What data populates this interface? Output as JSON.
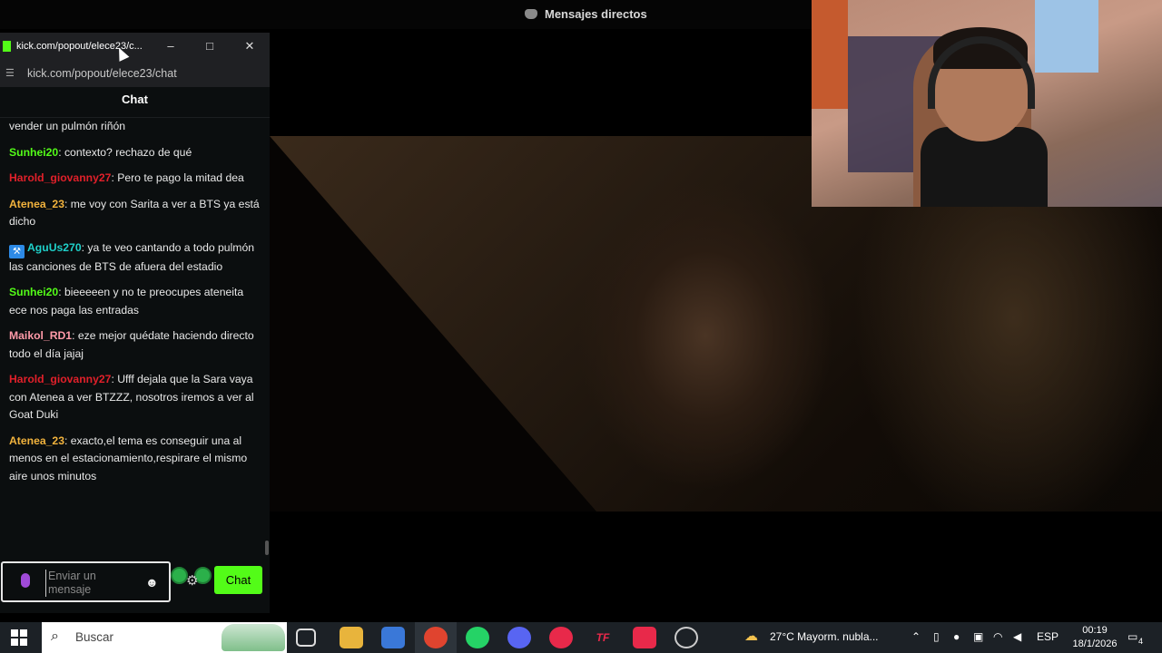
{
  "discord": {
    "title": "Mensajes directos"
  },
  "popout": {
    "title": "kick.com/popout/elece23/c...",
    "url": "kick.com/popout/elece23/chat",
    "minimize": "–",
    "maximize": "□",
    "close": "✕"
  },
  "chat": {
    "header": "Chat",
    "messages": [
      {
        "user": "",
        "text": "vender un pulmón riñón",
        "color": "#e8e8e8"
      },
      {
        "user": "Sunhei20",
        "text": ": contexto? rechazo de qué",
        "color": "#53fc18"
      },
      {
        "user": "Harold_giovanny27",
        "text": ": Pero te pago la mitad dea",
        "color": "#e0202a"
      },
      {
        "user": "Atenea_23",
        "text": ": me voy con Sarita a ver a BTS ya está dicho",
        "color": "#f2b33d"
      },
      {
        "user": "AguUs270",
        "text": ": ya te veo cantando a todo pulmón las canciones de BTS de afuera del estadio",
        "color": "#1fd0c9",
        "badge": true
      },
      {
        "user": "Sunhei20",
        "text": ": bieeeeen y no te preocupes ateneita ece nos paga las entradas",
        "color": "#53fc18"
      },
      {
        "user": "Maikol_RD1",
        "text": ": eze mejor quédate haciendo directo todo el día jajaj",
        "color": "#ff9aa8"
      },
      {
        "user": "Harold_giovanny27",
        "text": ": Ufff dejala que la Sara vaya con Atenea a ver BTZZZ, nosotros iremos a ver al Goat Duki",
        "color": "#e0202a"
      },
      {
        "user": "Atenea_23",
        "text": ": exacto,el tema es conseguir una al menos en el estacionamiento,respirare el mismo aire unos minutos",
        "color": "#f2b33d"
      }
    ],
    "input_placeholder": "Enviar un mensaje",
    "send_label": "Chat",
    "emotes": [
      "emote-1",
      "emote-2",
      "emote-3",
      "emote-4",
      "emote-5",
      "emote-6",
      "emote-7",
      "emote-8",
      "emote-9",
      "emote-10"
    ]
  },
  "taskbar": {
    "search_placeholder": "Buscar",
    "weather": "27°C  Mayorm. nubla...",
    "language": "ESP",
    "time": "00:19",
    "date": "18/1/2026",
    "notifications": "4"
  },
  "colors": {
    "kick_green": "#53fc18",
    "taskbar_bg": "#1c2126"
  }
}
